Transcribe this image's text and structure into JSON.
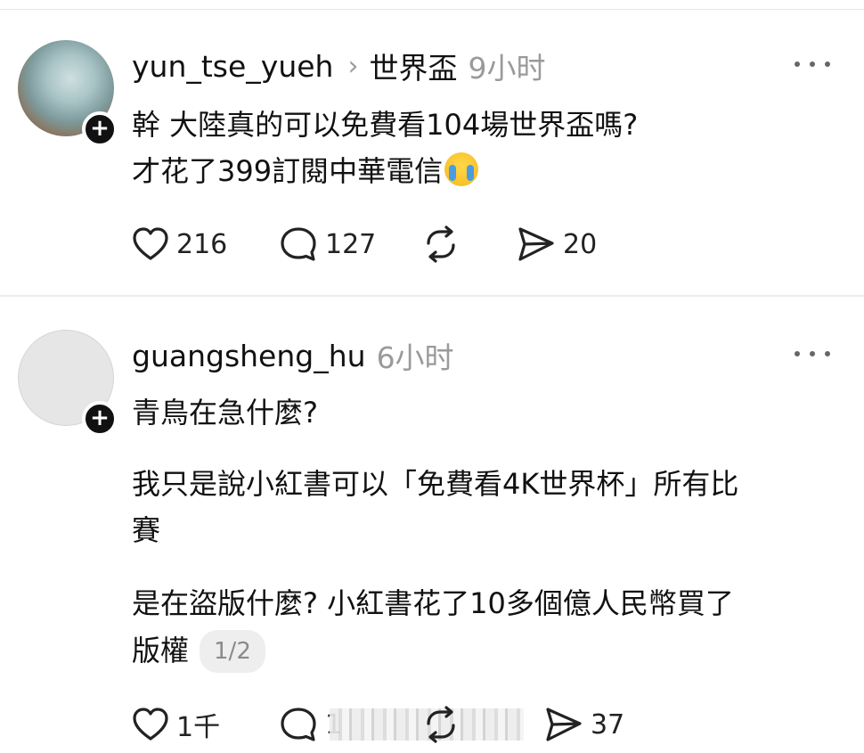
{
  "posts": [
    {
      "username": "yun_tse_yueh",
      "topic": "世界盃",
      "time": "9小时",
      "lines": [
        "幹 大陸真的可以免費看104場世界盃嗎?",
        "才花了399訂閱中華電信"
      ],
      "emoji": "loudly-crying-face",
      "likes": "216",
      "comments": "127",
      "shares": "20"
    },
    {
      "username": "guangsheng_hu",
      "time": "6小时",
      "lines": [
        "青鳥在急什麼?",
        "我只是說小紅書可以「免費看4K世界杯」所有比",
        "賽",
        "是在盜版什麼? 小紅書花了10多個億人民幣買了",
        "版權"
      ],
      "pager": "1/2",
      "likes": "1千",
      "comments": "1",
      "shares": "37"
    }
  ],
  "icons": {
    "avatar_badge": "plus-icon",
    "chevron": "chevron-right-icon",
    "more": "more-horizontal-icon",
    "like": "heart-icon",
    "comment": "comment-icon",
    "repost": "repost-icon",
    "share": "send-icon"
  },
  "symbols": {
    "plus": "+",
    "chevron": "›"
  }
}
